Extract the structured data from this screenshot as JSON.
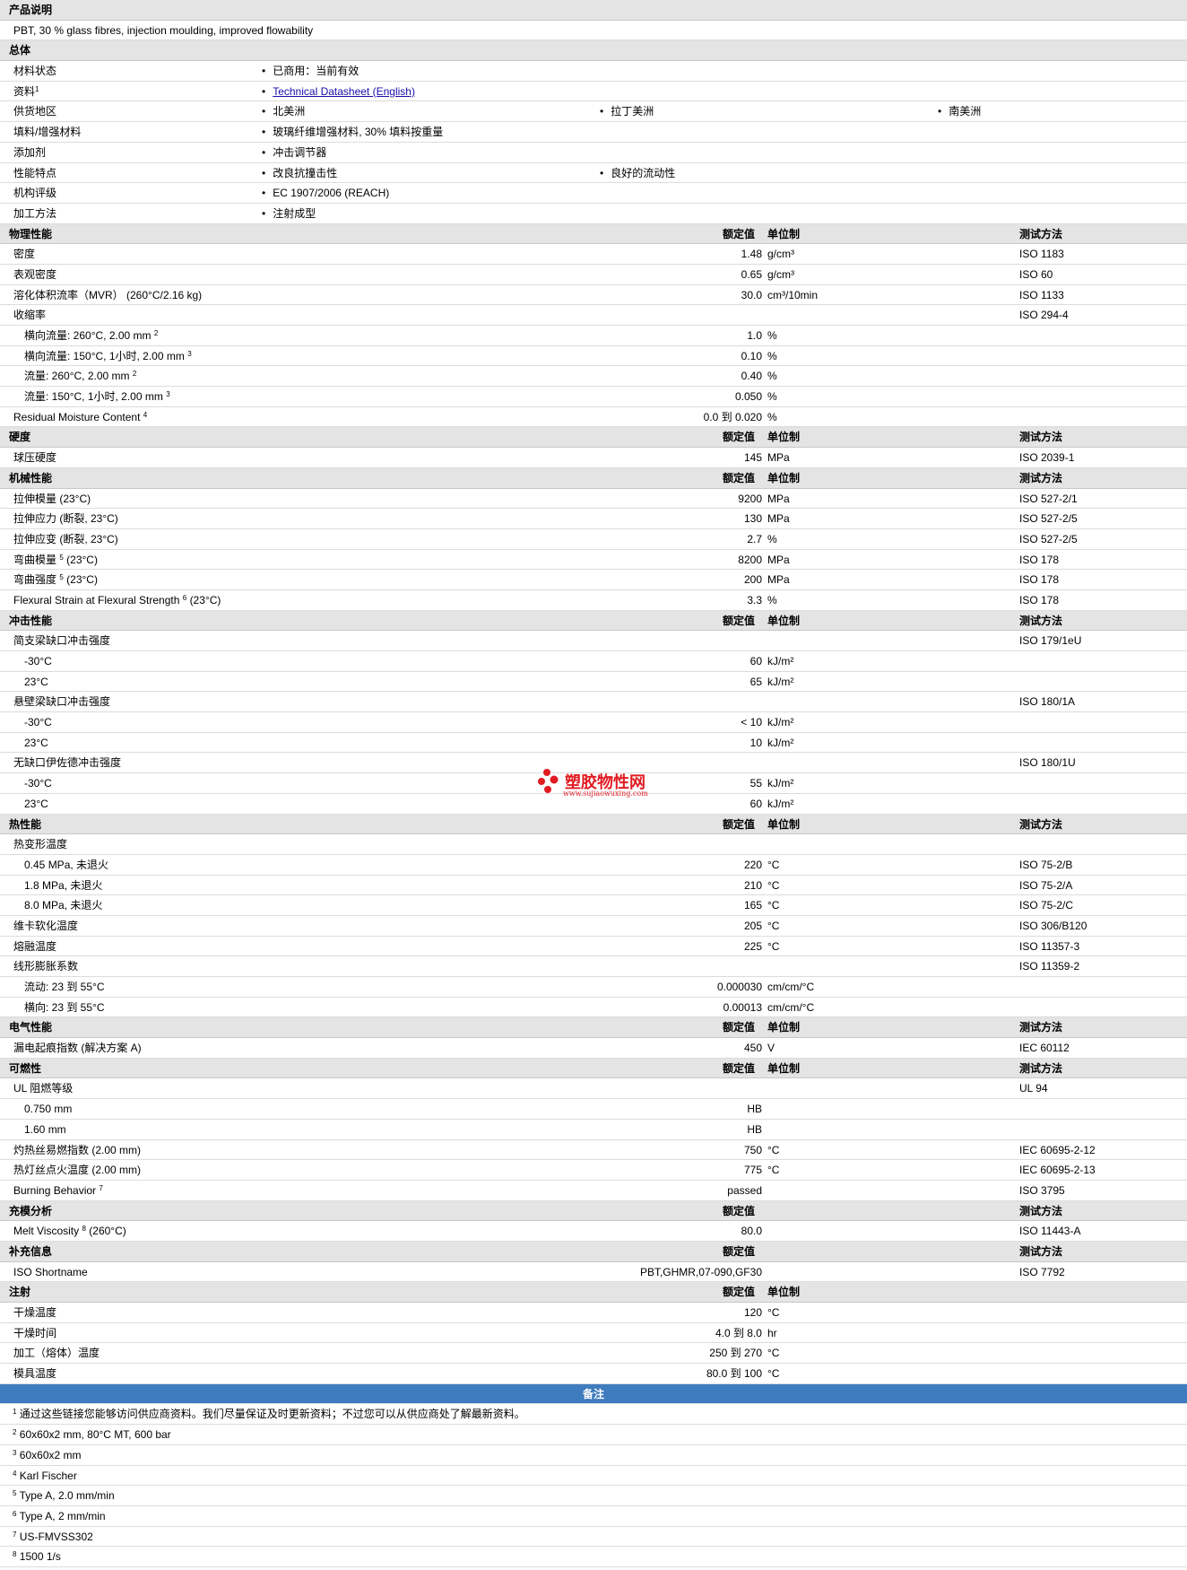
{
  "product": {
    "title": "产品说明",
    "desc": "PBT, 30 % glass fibres, injection moulding, improved flowability"
  },
  "general": {
    "title": "总体",
    "material_status": {
      "label": "材料状态",
      "value": "已商用：当前有效"
    },
    "docs": {
      "label": "资料",
      "sup": "1",
      "link": "Technical Datasheet (English)"
    },
    "regions": {
      "label": "供货地区",
      "v1": "北美洲",
      "v2": "拉丁美洲",
      "v3": "南美洲"
    },
    "filler": {
      "label": "填料/增强材料",
      "value": "玻璃纤维增强材料, 30% 填料按重量"
    },
    "additive": {
      "label": "添加剂",
      "value": "冲击调节器"
    },
    "features": {
      "label": "性能特点",
      "v1": "改良抗撞击性",
      "v2": "良好的流动性"
    },
    "agency": {
      "label": "机构评级",
      "value": "EC 1907/2006 (REACH)"
    },
    "process": {
      "label": "加工方法",
      "value": "注射成型"
    }
  },
  "hdr": {
    "value": "额定值",
    "unit": "单位制",
    "method": "测试方法"
  },
  "physical": {
    "title": "物理性能",
    "r1": {
      "label": "密度",
      "value": "1.48",
      "unit": "g/cm³",
      "method": "ISO 1183"
    },
    "r2": {
      "label": "表观密度",
      "value": "0.65",
      "unit": "g/cm³",
      "method": "ISO 60"
    },
    "r3": {
      "label": "溶化体积流率（MVR） (260°C/2.16 kg)",
      "value": "30.0",
      "unit": "cm³/10min",
      "method": "ISO 1133"
    },
    "r4": {
      "label": "收缩率",
      "method": "ISO 294-4"
    },
    "r5": {
      "label": "横向流量: 260°C, 2.00 mm",
      "sup": "2",
      "value": "1.0",
      "unit": "%"
    },
    "r6": {
      "label": "横向流量: 150°C, 1小时, 2.00 mm",
      "sup": "3",
      "value": "0.10",
      "unit": "%"
    },
    "r7": {
      "label": "流量: 260°C, 2.00 mm",
      "sup": "2",
      "value": "0.40",
      "unit": "%"
    },
    "r8": {
      "label": "流量: 150°C, 1小时, 2.00 mm",
      "sup": "3",
      "value": "0.050",
      "unit": "%"
    },
    "r9": {
      "label": "Residual Moisture Content",
      "sup": "4",
      "value": "0.0 到  0.020",
      "unit": "%"
    }
  },
  "hardness": {
    "title": "硬度",
    "r1": {
      "label": "球压硬度",
      "value": "145",
      "unit": "MPa",
      "method": "ISO 2039-1"
    }
  },
  "mechanical": {
    "title": "机械性能",
    "r1": {
      "label": "拉伸模量 (23°C)",
      "value": "9200",
      "unit": "MPa",
      "method": "ISO 527-2/1"
    },
    "r2": {
      "label": "拉伸应力 (断裂, 23°C)",
      "value": "130",
      "unit": "MPa",
      "method": "ISO 527-2/5"
    },
    "r3": {
      "label": "拉伸应变 (断裂, 23°C)",
      "value": "2.7",
      "unit": "%",
      "method": "ISO 527-2/5"
    },
    "r4": {
      "label": "弯曲模量",
      "sup": "5",
      "label2": "(23°C)",
      "value": "8200",
      "unit": "MPa",
      "method": "ISO 178"
    },
    "r5": {
      "label": "弯曲强度",
      "sup": "5",
      "label2": "(23°C)",
      "value": "200",
      "unit": "MPa",
      "method": "ISO 178"
    },
    "r6": {
      "label": "Flexural Strain at Flexural Strength",
      "sup": "6",
      "label2": "(23°C)",
      "value": "3.3",
      "unit": "%",
      "method": "ISO 178"
    }
  },
  "impact": {
    "title": "冲击性能",
    "r1": {
      "label": "简支梁缺口冲击强度",
      "method": "ISO 179/1eU"
    },
    "r2": {
      "label": "-30°C",
      "value": "60",
      "unit": "kJ/m²"
    },
    "r3": {
      "label": "23°C",
      "value": "65",
      "unit": "kJ/m²"
    },
    "r4": {
      "label": "悬壁梁缺口冲击强度",
      "method": "ISO 180/1A"
    },
    "r5": {
      "label": "-30°C",
      "value": "< 10",
      "unit": "kJ/m²"
    },
    "r6": {
      "label": "23°C",
      "value": "10",
      "unit": "kJ/m²"
    },
    "r7": {
      "label": "无缺口伊佐德冲击强度",
      "method": "ISO 180/1U"
    },
    "r8": {
      "label": "-30°C",
      "value": "55",
      "unit": "kJ/m²"
    },
    "r9": {
      "label": "23°C",
      "value": "60",
      "unit": "kJ/m²"
    }
  },
  "thermal": {
    "title": "热性能",
    "r1": {
      "label": "热变形温度"
    },
    "r2": {
      "label": "0.45 MPa, 未退火",
      "value": "220",
      "unit": "°C",
      "method": "ISO 75-2/B"
    },
    "r3": {
      "label": "1.8 MPa, 未退火",
      "value": "210",
      "unit": "°C",
      "method": "ISO 75-2/A"
    },
    "r4": {
      "label": "8.0 MPa, 未退火",
      "value": "165",
      "unit": "°C",
      "method": "ISO 75-2/C"
    },
    "r5": {
      "label": "维卡软化温度",
      "value": "205",
      "unit": "°C",
      "method": "ISO 306/B120"
    },
    "r6": {
      "label": "熔融温度",
      "value": "225",
      "unit": "°C",
      "method": "ISO 11357-3"
    },
    "r7": {
      "label": "线形膨胀系数",
      "method": "ISO 11359-2"
    },
    "r8": {
      "label": "流动: 23 到  55°C",
      "value": "0.000030",
      "unit": "cm/cm/°C"
    },
    "r9": {
      "label": "横向: 23 到  55°C",
      "value": "0.00013",
      "unit": "cm/cm/°C"
    }
  },
  "electrical": {
    "title": "电气性能",
    "r1": {
      "label": "漏电起痕指数 (解决方案  A)",
      "value": "450",
      "unit": "V",
      "method": "IEC 60112"
    }
  },
  "flammability": {
    "title": "可燃性",
    "r1": {
      "label": "UL 阻燃等级",
      "method": "UL 94"
    },
    "r2": {
      "label": "0.750 mm",
      "value": "HB"
    },
    "r3": {
      "label": "1.60 mm",
      "value": "HB"
    },
    "r4": {
      "label": "灼热丝易燃指数 (2.00 mm)",
      "value": "750",
      "unit": "°C",
      "method": "IEC 60695-2-12"
    },
    "r5": {
      "label": "热灯丝点火温度 (2.00 mm)",
      "value": "775",
      "unit": "°C",
      "method": "IEC 60695-2-13"
    },
    "r6": {
      "label": "Burning Behavior",
      "sup": "7",
      "value": "passed",
      "method": "ISO 3795"
    }
  },
  "filling": {
    "title": "充模分析",
    "r1": {
      "label": "Melt Viscosity",
      "sup": "8",
      "label2": "(260°C)",
      "value": "80.0",
      "method": "ISO 11443-A"
    }
  },
  "additional": {
    "title": "补充信息",
    "r1": {
      "label": "ISO Shortname",
      "value": "PBT,GHMR,07-090,GF30",
      "method": "ISO 7792"
    }
  },
  "injection": {
    "title": "注射",
    "r1": {
      "label": "干燥温度",
      "value": "120",
      "unit": "°C"
    },
    "r2": {
      "label": "干燥时间",
      "value": "4.0 到  8.0",
      "unit": "hr"
    },
    "r3": {
      "label": "加工（熔体）温度",
      "value": "250 到  270",
      "unit": "°C"
    },
    "r4": {
      "label": "模具温度",
      "value": "80.0 到  100",
      "unit": "°C"
    }
  },
  "notes": {
    "title": "备注",
    "n1": {
      "num": "1",
      "text": "通过这些链接您能够访问供应商资料。我们尽量保证及时更新资料；不过您可以从供应商处了解最新资料。"
    },
    "n2": {
      "num": "2",
      "text": "60x60x2 mm, 80°C MT, 600 bar"
    },
    "n3": {
      "num": "3",
      "text": "60x60x2 mm"
    },
    "n4": {
      "num": "4",
      "text": "Karl Fischer"
    },
    "n5": {
      "num": "5",
      "text": "Type A, 2.0 mm/min"
    },
    "n6": {
      "num": "6",
      "text": "Type A, 2 mm/min"
    },
    "n7": {
      "num": "7",
      "text": "US-FMVSS302"
    },
    "n8": {
      "num": "8",
      "text": "1500 1/s"
    }
  },
  "watermark": {
    "cn": "塑胶物性网",
    "url": "www.sujiaowuxing.com"
  },
  "colors": {
    "section_bg": "#e4e4e4",
    "header_blue": "#3f7cbf",
    "watermark_red": "#e11b22"
  }
}
